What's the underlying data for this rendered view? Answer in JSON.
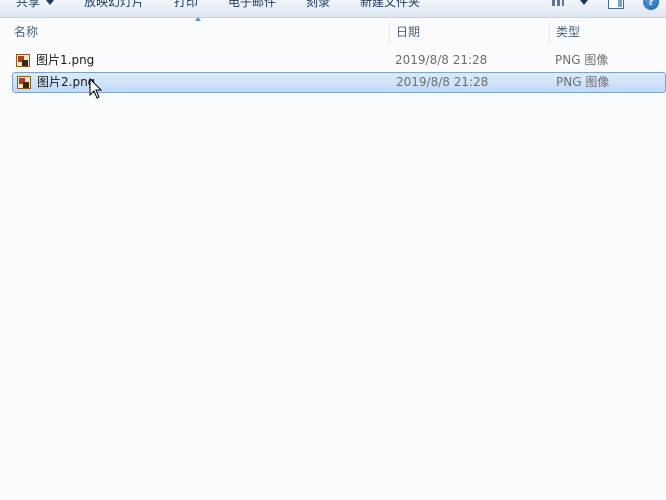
{
  "toolbar": {
    "share": "共享",
    "slideshow": "放映幻灯片",
    "print": "打印",
    "email": "电子邮件",
    "burn": "刻录",
    "new_folder": "新建文件夹",
    "help": "?"
  },
  "columns": {
    "name": "名称",
    "date": "日期",
    "type": "类型"
  },
  "files": [
    {
      "name": "图片1.png",
      "date": "2019/8/8 21:28",
      "type": "PNG 图像",
      "selected": false
    },
    {
      "name": "图片2.png",
      "date": "2019/8/8 21:28",
      "type": "PNG 图像",
      "selected": true
    }
  ],
  "colors": {
    "selection": "#c1dbfc",
    "selection_border": "#7da2ce",
    "background": "#fbfcfd"
  },
  "icons": {
    "file": "png-image-icon",
    "view": "view-options-icon",
    "preview": "preview-pane-icon",
    "help": "help-icon",
    "cursor": "mouse-pointer-icon"
  }
}
